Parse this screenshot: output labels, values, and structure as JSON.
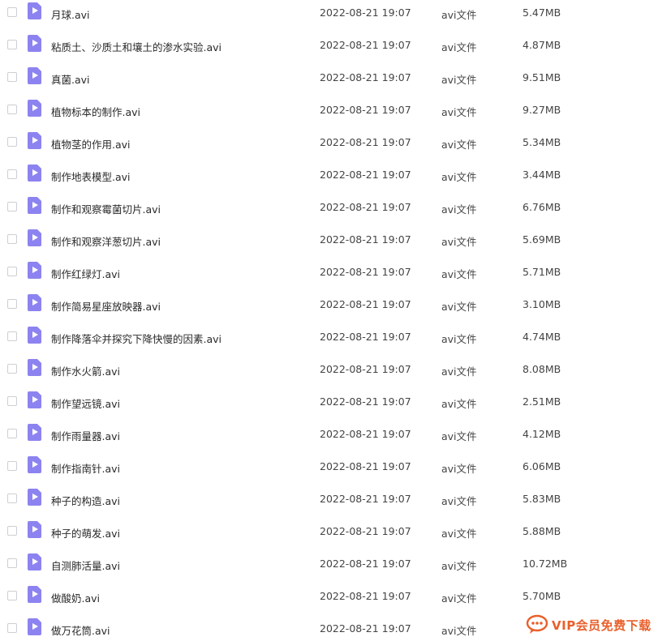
{
  "files": [
    {
      "name": "月球.avi",
      "date": "2022-08-21 19:07",
      "type": "avi文件",
      "size": "5.47MB"
    },
    {
      "name": "粘质土、沙质土和壤土的渗水实验.avi",
      "date": "2022-08-21 19:07",
      "type": "avi文件",
      "size": "4.87MB"
    },
    {
      "name": "真菌.avi",
      "date": "2022-08-21 19:07",
      "type": "avi文件",
      "size": "9.51MB"
    },
    {
      "name": "植物标本的制作.avi",
      "date": "2022-08-21 19:07",
      "type": "avi文件",
      "size": "9.27MB"
    },
    {
      "name": "植物茎的作用.avi",
      "date": "2022-08-21 19:07",
      "type": "avi文件",
      "size": "5.34MB"
    },
    {
      "name": "制作地表模型.avi",
      "date": "2022-08-21 19:07",
      "type": "avi文件",
      "size": "3.44MB"
    },
    {
      "name": "制作和观察霉菌切片.avi",
      "date": "2022-08-21 19:07",
      "type": "avi文件",
      "size": "6.76MB"
    },
    {
      "name": "制作和观察洋葱切片.avi",
      "date": "2022-08-21 19:07",
      "type": "avi文件",
      "size": "5.69MB"
    },
    {
      "name": "制作红绿灯.avi",
      "date": "2022-08-21 19:07",
      "type": "avi文件",
      "size": "5.71MB"
    },
    {
      "name": "制作简易星座放映器.avi",
      "date": "2022-08-21 19:07",
      "type": "avi文件",
      "size": "3.10MB"
    },
    {
      "name": "制作降落伞并探究下降快慢的因素.avi",
      "date": "2022-08-21 19:07",
      "type": "avi文件",
      "size": "4.74MB"
    },
    {
      "name": "制作水火箭.avi",
      "date": "2022-08-21 19:07",
      "type": "avi文件",
      "size": "8.08MB"
    },
    {
      "name": "制作望远镜.avi",
      "date": "2022-08-21 19:07",
      "type": "avi文件",
      "size": "2.51MB"
    },
    {
      "name": "制作雨量器.avi",
      "date": "2022-08-21 19:07",
      "type": "avi文件",
      "size": "4.12MB"
    },
    {
      "name": "制作指南针.avi",
      "date": "2022-08-21 19:07",
      "type": "avi文件",
      "size": "6.06MB"
    },
    {
      "name": "种子的构造.avi",
      "date": "2022-08-21 19:07",
      "type": "avi文件",
      "size": "5.83MB"
    },
    {
      "name": "种子的萌发.avi",
      "date": "2022-08-21 19:07",
      "type": "avi文件",
      "size": "5.88MB"
    },
    {
      "name": "自测肺活量.avi",
      "date": "2022-08-21 19:07",
      "type": "avi文件",
      "size": "10.72MB"
    },
    {
      "name": "做酸奶.avi",
      "date": "2022-08-21 19:07",
      "type": "avi文件",
      "size": "5.70MB"
    },
    {
      "name": "做万花筒.avi",
      "date": "2022-08-21 19:07",
      "type": "avi文件",
      "size": ""
    }
  ],
  "file_icon": "video-file-icon",
  "checkbox_icon": "checkbox-icon",
  "accent_color": "#8d83f0",
  "watermark": {
    "text": "VIP会员免费下载",
    "icon": "chat-bubble-icon",
    "color": "#e8602c"
  }
}
